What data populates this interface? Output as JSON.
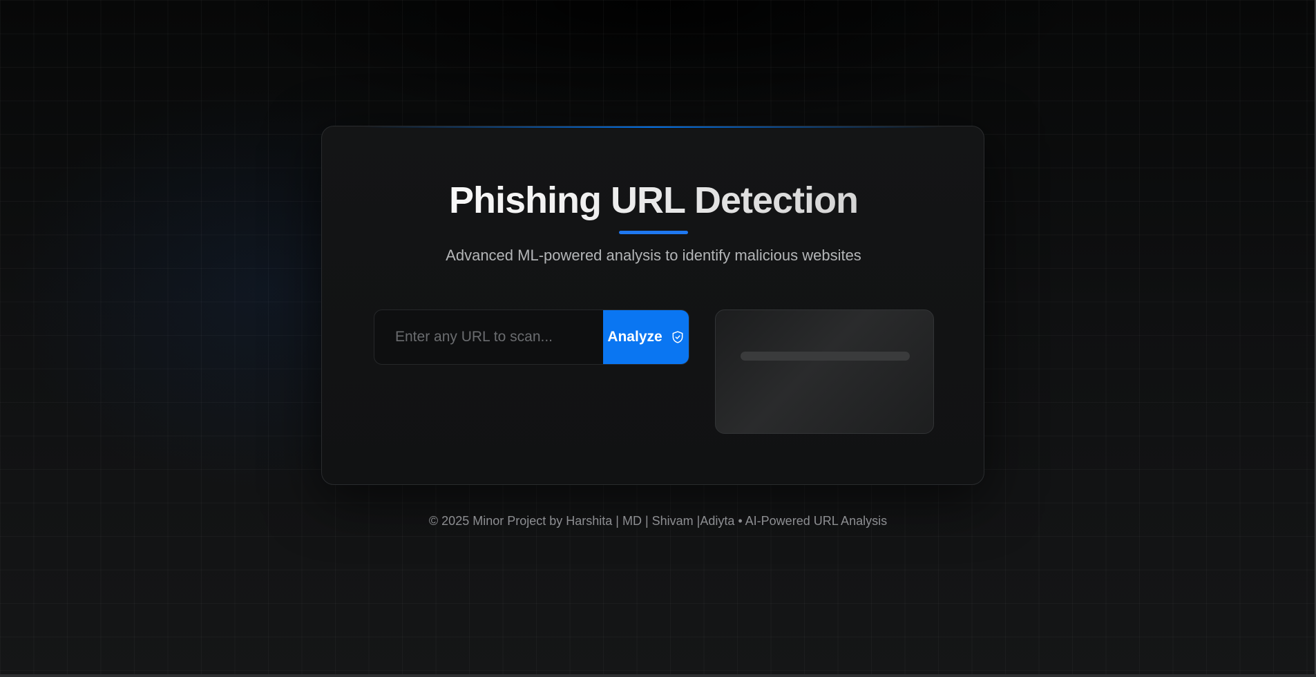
{
  "header": {
    "title": "Phishing URL Detection",
    "subtitle": "Advanced ML-powered analysis to identify malicious websites"
  },
  "search": {
    "placeholder": "Enter any URL to scan...",
    "value": "",
    "button_label": "Analyze",
    "button_icon": "shield-check-icon"
  },
  "result_panel": {
    "state": "loading-skeleton"
  },
  "footer": {
    "text": "© 2025 Minor Project by Harshita | MD | Shivam |Adiyta • AI-Powered URL Analysis"
  },
  "colors": {
    "accent": "#0a76f2",
    "background": "#0c0d0e",
    "card": "#131415",
    "text_primary": "#f2f2f2",
    "text_secondary": "#b4b6b8",
    "footer_text": "#8d8f92"
  }
}
